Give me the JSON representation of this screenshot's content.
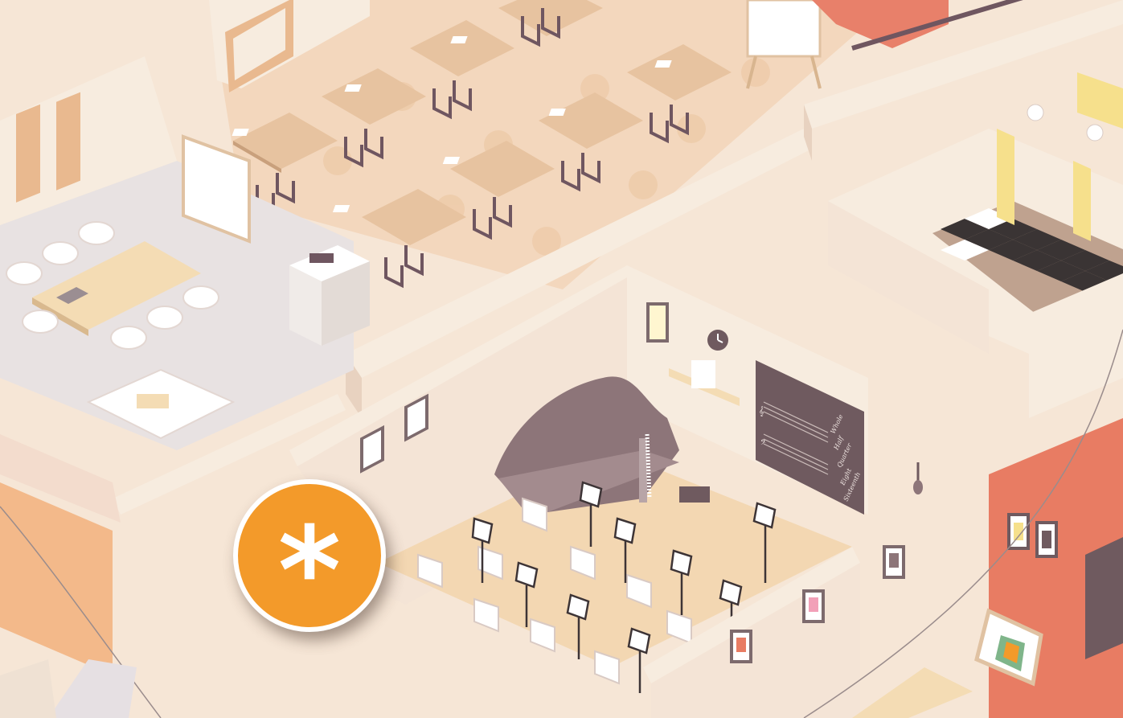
{
  "scene": {
    "description_label": "",
    "palette": {
      "floor": "#f6e6d6",
      "wall": "#f7ecdf",
      "wall_shadow": "#e8d2c0",
      "desk": "#e7c3a0",
      "chair_frame": "#6f5660",
      "piano": "#8d7579",
      "board": "#6f5a5f",
      "accent_orange": "#f39a2a",
      "checker_dark": "#3a3434",
      "art_wall": "#e87c63",
      "pathway": "#efe1d3"
    }
  },
  "hotspot": {
    "glyph": "*",
    "icon": "asterisk-icon",
    "color": "#f39a2a"
  },
  "music_board": {
    "clefs": [
      "𝄞",
      "𝄢"
    ],
    "note_list": [
      "Whole",
      "Half",
      "Quarter",
      "Eight",
      "Sixteenth"
    ]
  }
}
